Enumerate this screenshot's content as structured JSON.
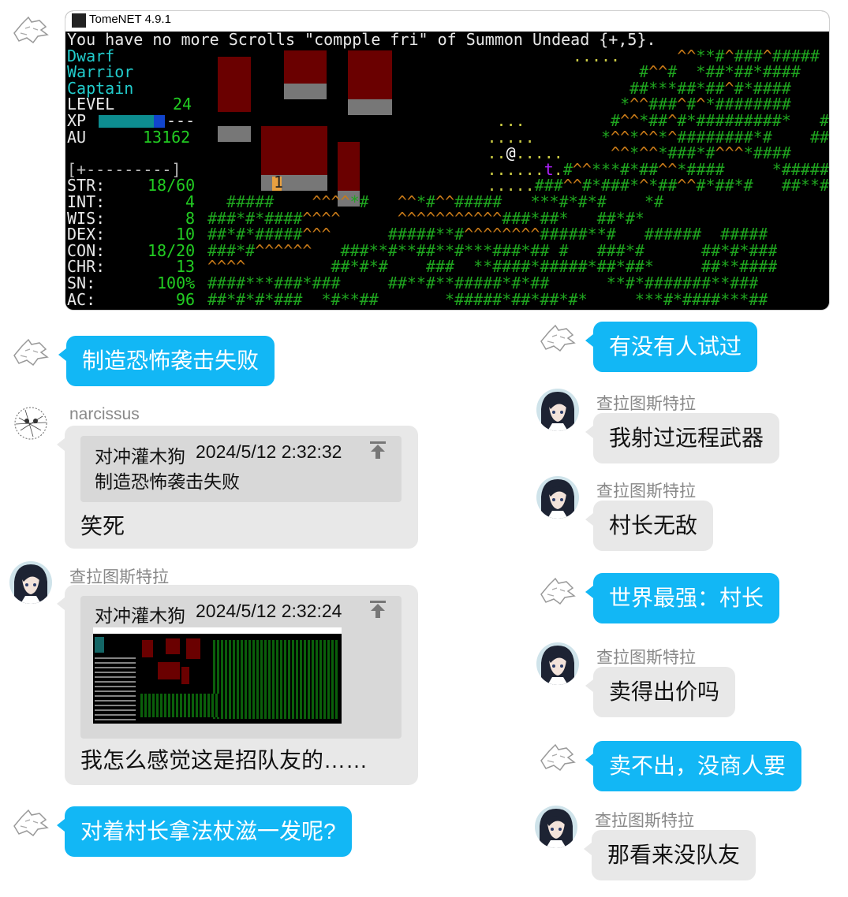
{
  "game": {
    "window_title": "TomeNET 4.9.1",
    "message": "You have no more Scrolls \"compple fri\" of Summon Undead {+,5}.",
    "race": "Dwarf",
    "class": "Warrior",
    "title": "Captain",
    "stats": [
      {
        "label": "LEVEL",
        "value": "24"
      },
      {
        "label": "XP",
        "value": "---"
      },
      {
        "label": "AU",
        "value": "13162"
      }
    ],
    "exp_bar": "[+---------]",
    "attrs": [
      {
        "label": "STR:",
        "value": "18/60"
      },
      {
        "label": "INT:",
        "value": "4"
      },
      {
        "label": "WIS:",
        "value": "8"
      },
      {
        "label": "DEX:",
        "value": "10"
      },
      {
        "label": "CON:",
        "value": "18/20"
      },
      {
        "label": "CHR:",
        "value": "13"
      },
      {
        "label": "SN:",
        "value": "100%"
      },
      {
        "label": "AC:",
        "value": "96"
      }
    ],
    "map_rows": [
      "                     .....      ^^**#^###^#####    #########*#",
      "                            #^^#  *##*##*####     *#**####*##",
      "                           ##***##*##^#*####    ###*#*####*##",
      "                          *^^###^#^*########    ##*##*###**##",
      "             ...         #^^*##^#*#########*   ##**#*##*##*##",
      "            .....       *^^*^^*^########*#    ####*####*#*##",
      "            ..@.....     ^^*^^*###*#^^^*####    #####*###  #*",
      "            ......t.#^^***#*##^^*####     *#####*##  #",
      "            .....###^^#*###*^*##^^#*##*#   ##**##*####*##",
      "  #####    ^^^^*#   ^^*#^^#####   ***#*#*#    *#",
      "###*#*####^^^^      ^^^^^^^^^^^###*##*   ##*#*",
      "##*#*#####^^^      #####**#^^^^^^^^#####**#   ######  #####",
      "###*#^^^^^^   ###**#**##**#***###*## #   ###*#      ##*#*###",
      "^^^^         ##*#*#    ###  **####*#####*##*##*     ##**####",
      "####***###*###     ##**#**#####*#*##      **#*#######**###",
      "##*#*#*###  *#**##       *#####*##*##*#*     ***#*####***##"
    ],
    "status_marker": "1",
    "chart_values": {
      "exp_fraction": 0.8
    }
  },
  "messages": [
    {
      "sender": "",
      "text": "制造恐怖袭击失败",
      "side": "left"
    },
    {
      "sender": "narcissus",
      "quote_author": "对冲灌木狗",
      "quote_time": "2024/5/12 2:32:32",
      "quote_text": "制造恐怖袭击失败",
      "text": "笑死"
    },
    {
      "sender": "查拉图斯特拉",
      "quote_author": "对冲灌木狗",
      "quote_time": "2024/5/12 2:32:24",
      "text": "我怎么感觉这是招队友的……"
    },
    {
      "sender": "",
      "text": "对着村长拿法杖滋一发呢?"
    },
    {
      "sender": "",
      "text": "有没有人试过"
    },
    {
      "sender": "查拉图斯特拉",
      "text": "我射过远程武器"
    },
    {
      "sender": "查拉图斯特拉",
      "text": "村长无敌"
    },
    {
      "sender": "",
      "text": "世界最强：村长"
    },
    {
      "sender": "查拉图斯特拉",
      "text": "卖得出价吗"
    },
    {
      "sender": "",
      "text": "卖不出，没商人要"
    },
    {
      "sender": "查拉图斯特拉",
      "text": "那看来没队友"
    }
  ]
}
